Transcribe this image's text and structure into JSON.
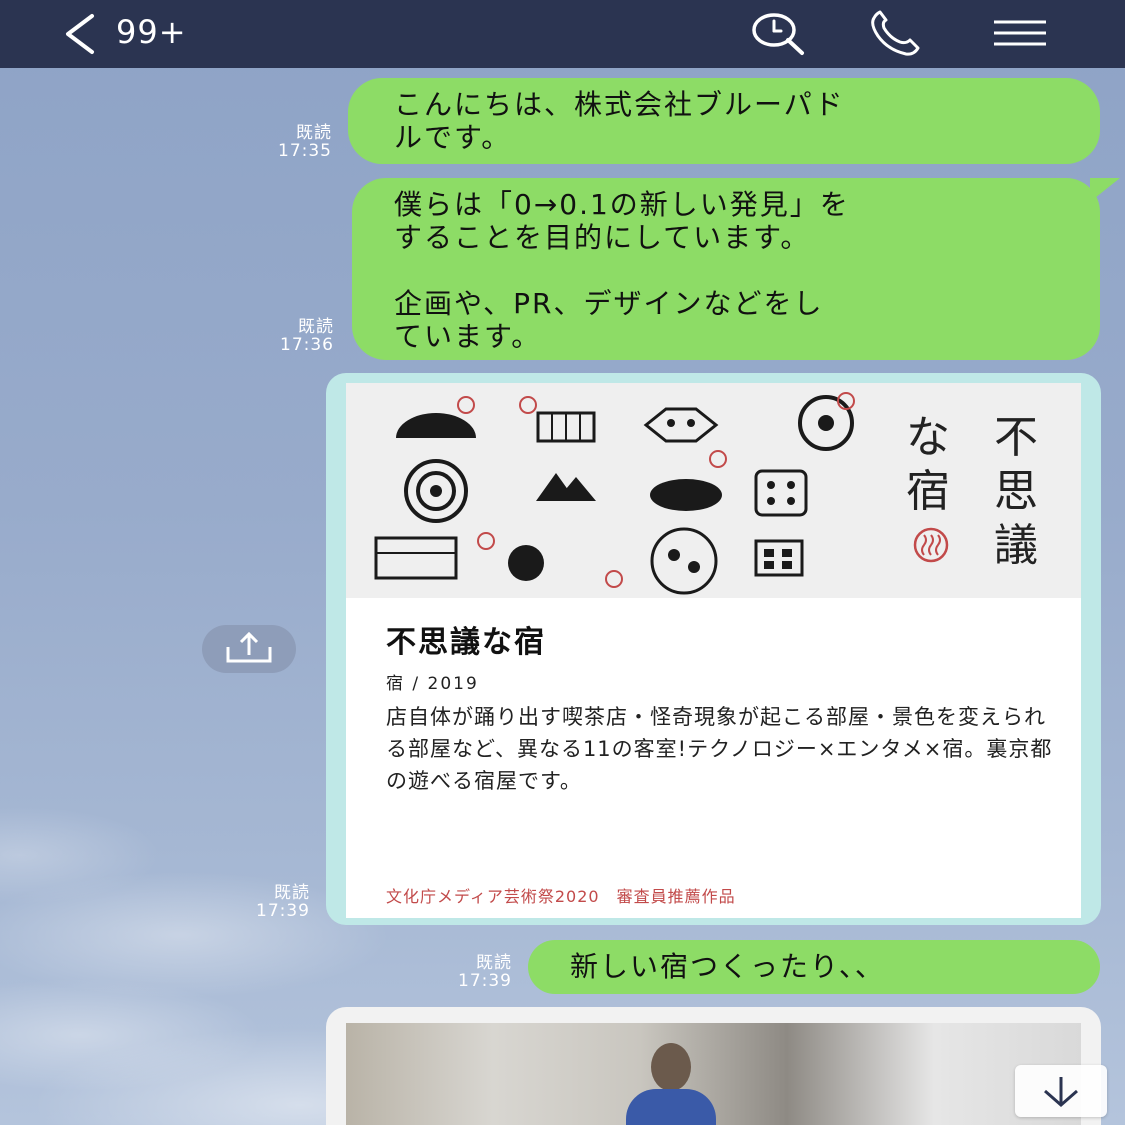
{
  "header": {
    "unread_count": "99+",
    "back_icon": "chevron-left-icon",
    "search_icon": "search-icon",
    "call_icon": "phone-icon",
    "menu_icon": "hamburger-menu-icon",
    "bg_color": "#2b3451"
  },
  "messages": [
    {
      "read_label": "既読",
      "time": "17:35",
      "text": "こんにちは、株式会社ブルーパド\nルです。"
    },
    {
      "read_label": "既読",
      "time": "17:36",
      "text": "僕らは「0→0.1の新しい発見」を\nすることを目的にしています。\n\n企画や、PR、デザインなどをし\nています。"
    },
    {
      "read_label": "既読",
      "time": "17:39",
      "text": "新しい宿つくったり、、"
    }
  ],
  "card": {
    "time_label": "既読",
    "time": "17:39",
    "hero_title_col1": "な宿",
    "hero_title_col2": "不思議",
    "title": "不思議な宿",
    "subtitle": "宿 / 2019",
    "description": "店自体が踊り出す喫茶店・怪奇現象が起こる部屋・景色を変えられる部屋など、異なる11の客室!テクノロジー×エンタメ×宿。裏京都の遊べる宿屋です。",
    "award": "文化庁メディア芸術祭2020　審査員推薦作品"
  },
  "colors": {
    "bubble": "#8ddc66",
    "card_border": "#bfe8e7",
    "award_text": "#c24a4a"
  },
  "share_icon": "share-icon",
  "scroll_icon": "arrow-down-icon"
}
